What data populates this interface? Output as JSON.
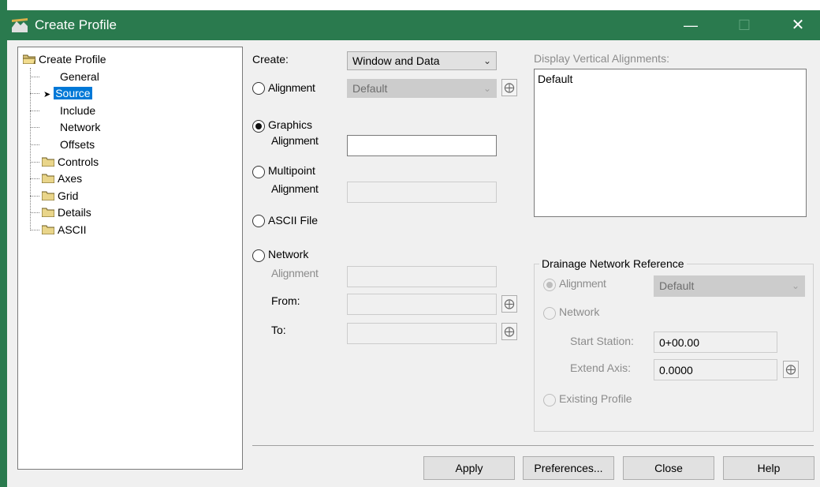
{
  "window": {
    "title": "Create Profile"
  },
  "tree": {
    "root": "Create Profile",
    "items": [
      {
        "label": "General"
      },
      {
        "label": "Source",
        "selected": true
      },
      {
        "label": "Include"
      },
      {
        "label": "Network"
      },
      {
        "label": "Offsets"
      }
    ],
    "folders": [
      "Controls",
      "Axes",
      "Grid",
      "Details",
      "ASCII"
    ]
  },
  "create": {
    "label": "Create:",
    "value": "Window and Data"
  },
  "source": {
    "alignment": {
      "label": "Alignment",
      "value": "Default"
    },
    "graphics": {
      "label": "Graphics",
      "sublabel": "Alignment",
      "value": ""
    },
    "multipoint": {
      "label": "Multipoint",
      "sublabel": "Alignment",
      "value": ""
    },
    "ascii": {
      "label": "ASCII File"
    },
    "network": {
      "label": "Network",
      "sublabel": "Alignment",
      "from_label": "From:",
      "to_label": "To:"
    }
  },
  "vertical": {
    "label": "Display Vertical Alignments:",
    "items": [
      "Default"
    ]
  },
  "drainage": {
    "title": "Drainage Network Reference",
    "alignment_label": "Alignment",
    "alignment_value": "Default",
    "network_label": "Network",
    "start_station_label": "Start Station:",
    "start_station_value": "0+00.00",
    "extend_axis_label": "Extend Axis:",
    "extend_axis_value": "0.0000",
    "existing_profile_label": "Existing Profile"
  },
  "buttons": {
    "apply": "Apply",
    "preferences": "Preferences...",
    "close": "Close",
    "help": "Help"
  }
}
